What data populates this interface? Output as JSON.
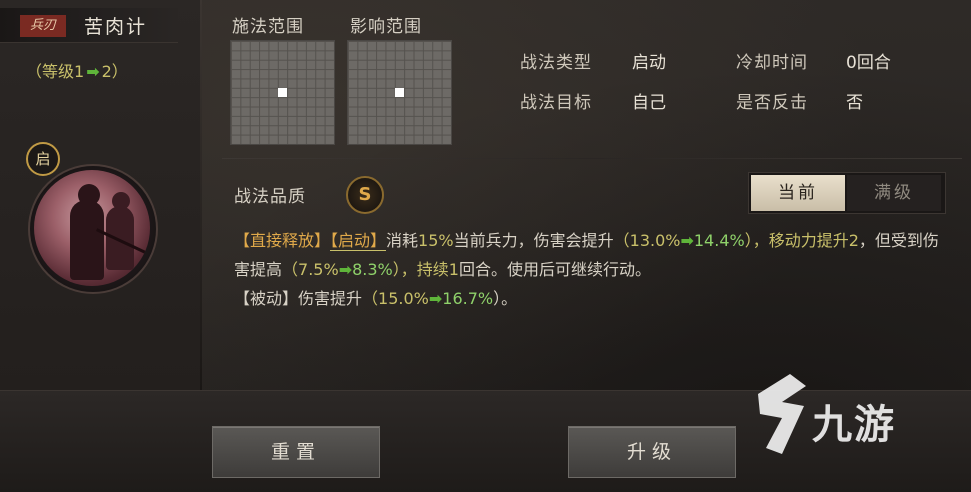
{
  "skill": {
    "type_tag": "兵刃",
    "name": "苦肉计",
    "level_prefix": "（等级1",
    "level_arrow": "➡",
    "level_suffix": "2）",
    "start_badge": "启"
  },
  "ranges": {
    "cast_label": "施法范围",
    "effect_label": "影响范围"
  },
  "attributes": {
    "type_label": "战法类型",
    "type_value": "启动",
    "target_label": "战法目标",
    "target_value": "自己",
    "cooldown_label": "冷却时间",
    "cooldown_value": "0回合",
    "counter_label": "是否反击",
    "counter_value": "否"
  },
  "quality": {
    "label": "战法品质",
    "grade": "S"
  },
  "toggle": {
    "current": "当前",
    "max": "满级"
  },
  "description": {
    "tag1": "【直接释放】",
    "tag2": "【启动】",
    "p1": "消耗",
    "p1_num": "15%",
    "p2": "当前兵力，伤害会提升",
    "v1_open": "（",
    "v1_a": "13.0%",
    "v1_b": "14.4%",
    "v1_close": "），移动力提升",
    "p3_num": "2",
    "p3": "，但受到伤害提高",
    "v2_open": "（",
    "v2_a": "7.5%",
    "v2_b": "8.3%",
    "v2_close": "），持续",
    "p4_num": "1",
    "p4": "回合。使用后可继续行动。",
    "passive_tag": "【被动】",
    "passive_text": "伤害提升",
    "v3_open": "（",
    "v3_a": "15.0%",
    "v3_b": "16.7%",
    "v3_close": "）。",
    "arrow": "➡"
  },
  "buttons": {
    "reset": "重置",
    "upgrade": "升级"
  },
  "watermark": {
    "text": "九游"
  }
}
